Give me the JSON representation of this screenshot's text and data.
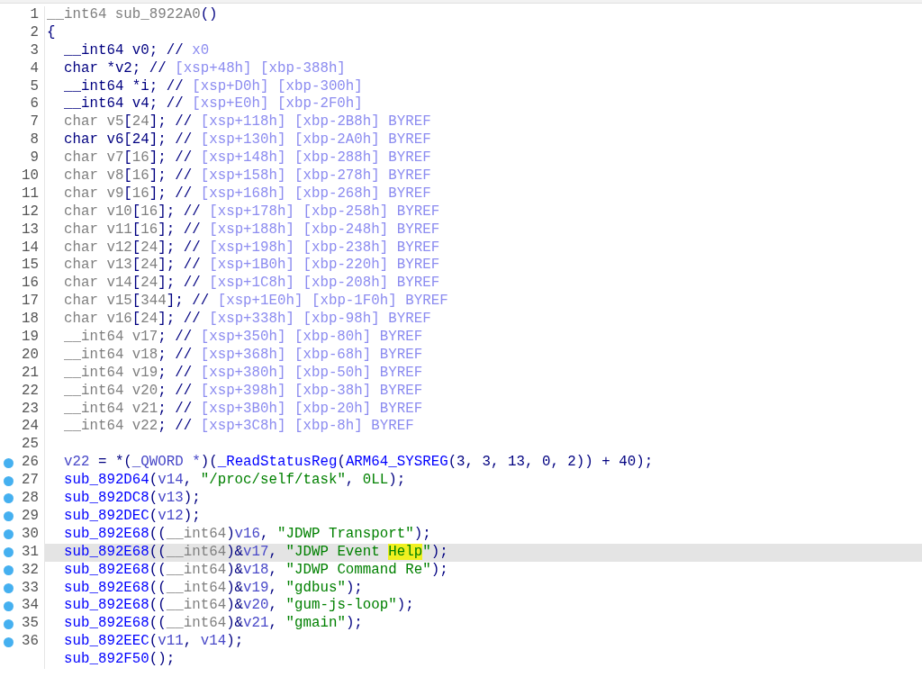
{
  "code_view": {
    "lines": [
      {
        "number": "1",
        "breakpoint": false,
        "selected": false,
        "segments": [
          {
            "kind": "g",
            "text": "__int64 sub_8922A0"
          },
          {
            "kind": "t",
            "text": "()"
          }
        ]
      },
      {
        "number": "2",
        "breakpoint": false,
        "selected": false,
        "segments": [
          {
            "kind": "t",
            "text": "{"
          }
        ],
        "children": [
          {
            "number": "3",
            "breakpoint": false,
            "selected": false,
            "segments": [
              {
                "kind": "t",
                "text": "__int64 v0; // "
              },
              {
                "kind": "c",
                "text": "x0"
              }
            ]
          },
          {
            "number": "4",
            "breakpoint": false,
            "selected": false,
            "segments": [
              {
                "kind": "t",
                "text": "char *v2; // "
              },
              {
                "kind": "c",
                "text": "[xsp+48h] [xbp-388h]"
              }
            ]
          },
          {
            "number": "5",
            "breakpoint": false,
            "selected": false,
            "segments": [
              {
                "kind": "t",
                "text": "__int64 *i; // "
              },
              {
                "kind": "c",
                "text": "[xsp+D0h] [xbp-300h]"
              }
            ]
          },
          {
            "number": "6",
            "breakpoint": false,
            "selected": false,
            "segments": [
              {
                "kind": "t",
                "text": "__int64 v4; // "
              },
              {
                "kind": "c",
                "text": "[xsp+E0h] [xbp-2F0h]"
              }
            ]
          },
          {
            "number": "7",
            "breakpoint": false,
            "selected": false,
            "segments": [
              {
                "kind": "g",
                "text": "char v5"
              },
              {
                "kind": "t",
                "text": "["
              },
              {
                "kind": "g",
                "text": "24"
              },
              {
                "kind": "t",
                "text": "]; // "
              },
              {
                "kind": "c",
                "text": "[xsp+118h] [xbp-2B8h] BYREF"
              }
            ]
          },
          {
            "number": "8",
            "breakpoint": false,
            "selected": false,
            "segments": [
              {
                "kind": "t",
                "text": "char v6[24]; // "
              },
              {
                "kind": "c",
                "text": "[xsp+130h] [xbp-2A0h] BYREF"
              }
            ]
          },
          {
            "number": "9",
            "breakpoint": false,
            "selected": false,
            "segments": [
              {
                "kind": "g",
                "text": "char v7"
              },
              {
                "kind": "t",
                "text": "["
              },
              {
                "kind": "g",
                "text": "16"
              },
              {
                "kind": "t",
                "text": "]; // "
              },
              {
                "kind": "c",
                "text": "[xsp+148h] [xbp-288h] BYREF"
              }
            ]
          },
          {
            "number": "10",
            "breakpoint": false,
            "selected": false,
            "segments": [
              {
                "kind": "g",
                "text": "char v8"
              },
              {
                "kind": "t",
                "text": "["
              },
              {
                "kind": "g",
                "text": "16"
              },
              {
                "kind": "t",
                "text": "]; // "
              },
              {
                "kind": "c",
                "text": "[xsp+158h] [xbp-278h] BYREF"
              }
            ]
          },
          {
            "number": "11",
            "breakpoint": false,
            "selected": false,
            "segments": [
              {
                "kind": "g",
                "text": "char v9"
              },
              {
                "kind": "t",
                "text": "["
              },
              {
                "kind": "g",
                "text": "16"
              },
              {
                "kind": "t",
                "text": "]; // "
              },
              {
                "kind": "c",
                "text": "[xsp+168h] [xbp-268h] BYREF"
              }
            ]
          },
          {
            "number": "12",
            "breakpoint": false,
            "selected": false,
            "segments": [
              {
                "kind": "g",
                "text": "char v10"
              },
              {
                "kind": "t",
                "text": "["
              },
              {
                "kind": "g",
                "text": "16"
              },
              {
                "kind": "t",
                "text": "]; // "
              },
              {
                "kind": "c",
                "text": "[xsp+178h] [xbp-258h] BYREF"
              }
            ]
          },
          {
            "number": "13",
            "breakpoint": false,
            "selected": false,
            "segments": [
              {
                "kind": "g",
                "text": "char v11"
              },
              {
                "kind": "t",
                "text": "["
              },
              {
                "kind": "g",
                "text": "16"
              },
              {
                "kind": "t",
                "text": "]; // "
              },
              {
                "kind": "c",
                "text": "[xsp+188h] [xbp-248h] BYREF"
              }
            ]
          },
          {
            "number": "14",
            "breakpoint": false,
            "selected": false,
            "segments": [
              {
                "kind": "g",
                "text": "char v12"
              },
              {
                "kind": "t",
                "text": "["
              },
              {
                "kind": "g",
                "text": "24"
              },
              {
                "kind": "t",
                "text": "]; // "
              },
              {
                "kind": "c",
                "text": "[xsp+198h] [xbp-238h] BYREF"
              }
            ]
          },
          {
            "number": "15",
            "breakpoint": false,
            "selected": false,
            "segments": [
              {
                "kind": "g",
                "text": "char v13"
              },
              {
                "kind": "t",
                "text": "["
              },
              {
                "kind": "g",
                "text": "24"
              },
              {
                "kind": "t",
                "text": "]; // "
              },
              {
                "kind": "c",
                "text": "[xsp+1B0h] [xbp-220h] BYREF"
              }
            ]
          },
          {
            "number": "16",
            "breakpoint": false,
            "selected": false,
            "segments": [
              {
                "kind": "g",
                "text": "char v14"
              },
              {
                "kind": "t",
                "text": "["
              },
              {
                "kind": "g",
                "text": "24"
              },
              {
                "kind": "t",
                "text": "]; // "
              },
              {
                "kind": "c",
                "text": "[xsp+1C8h] [xbp-208h] BYREF"
              }
            ]
          },
          {
            "number": "17",
            "breakpoint": false,
            "selected": false,
            "segments": [
              {
                "kind": "g",
                "text": "char v15"
              },
              {
                "kind": "t",
                "text": "["
              },
              {
                "kind": "g",
                "text": "344"
              },
              {
                "kind": "t",
                "text": "]; // "
              },
              {
                "kind": "c",
                "text": "[xsp+1E0h] [xbp-1F0h] BYREF"
              }
            ]
          },
          {
            "number": "18",
            "breakpoint": false,
            "selected": false,
            "segments": [
              {
                "kind": "g",
                "text": "char v16"
              },
              {
                "kind": "t",
                "text": "["
              },
              {
                "kind": "g",
                "text": "24"
              },
              {
                "kind": "t",
                "text": "]; // "
              },
              {
                "kind": "c",
                "text": "[xsp+338h] [xbp-98h] BYREF"
              }
            ]
          },
          {
            "number": "19",
            "breakpoint": false,
            "selected": false,
            "segments": [
              {
                "kind": "g",
                "text": "__int64 v17"
              },
              {
                "kind": "t",
                "text": "; // "
              },
              {
                "kind": "c",
                "text": "[xsp+350h] [xbp-80h] BYREF"
              }
            ]
          },
          {
            "number": "20",
            "breakpoint": false,
            "selected": false,
            "segments": [
              {
                "kind": "g",
                "text": "__int64 v18"
              },
              {
                "kind": "t",
                "text": "; // "
              },
              {
                "kind": "c",
                "text": "[xsp+368h] [xbp-68h] BYREF"
              }
            ]
          },
          {
            "number": "21",
            "breakpoint": false,
            "selected": false,
            "segments": [
              {
                "kind": "g",
                "text": "__int64 v19"
              },
              {
                "kind": "t",
                "text": "; // "
              },
              {
                "kind": "c",
                "text": "[xsp+380h] [xbp-50h] BYREF"
              }
            ]
          },
          {
            "number": "22",
            "breakpoint": false,
            "selected": false,
            "segments": [
              {
                "kind": "g",
                "text": "__int64 v20"
              },
              {
                "kind": "t",
                "text": "; // "
              },
              {
                "kind": "c",
                "text": "[xsp+398h] [xbp-38h] BYREF"
              }
            ]
          },
          {
            "number": "23",
            "breakpoint": false,
            "selected": false,
            "segments": [
              {
                "kind": "g",
                "text": "__int64 v21"
              },
              {
                "kind": "t",
                "text": "; // "
              },
              {
                "kind": "c",
                "text": "[xsp+3B0h] [xbp-20h] BYREF"
              }
            ]
          },
          {
            "number": "24",
            "breakpoint": false,
            "selected": false,
            "segments": [
              {
                "kind": "g",
                "text": "__int64 v22"
              },
              {
                "kind": "t",
                "text": "; // "
              },
              {
                "kind": "c",
                "text": "[xsp+3C8h] [xbp-8h] BYREF"
              }
            ]
          },
          {
            "number": "25",
            "breakpoint": false,
            "selected": false
          },
          {
            "number": "26",
            "breakpoint": true,
            "selected": false,
            "segments": [
              {
                "kind": "v",
                "text": "v22"
              },
              {
                "kind": "t",
                "text": " = *("
              },
              {
                "kind": "v",
                "text": "_QWORD *"
              },
              {
                "kind": "t",
                "text": ")("
              },
              {
                "kind": "f",
                "text": "_ReadStatusReg"
              },
              {
                "kind": "t",
                "text": "("
              },
              {
                "kind": "f",
                "text": "ARM64_SYSREG"
              },
              {
                "kind": "t",
                "text": "(3, 3, 13, 0, 2)) + 40);"
              }
            ]
          },
          {
            "number": "27",
            "breakpoint": true,
            "selected": false,
            "segments": [
              {
                "kind": "f",
                "text": "sub_892D64"
              },
              {
                "kind": "t",
                "text": "("
              },
              {
                "kind": "v",
                "text": "v14"
              },
              {
                "kind": "t",
                "text": ", "
              },
              {
                "kind": "s",
                "text": "\"/proc/self/task\""
              },
              {
                "kind": "t",
                "text": ", "
              },
              {
                "kind": "s",
                "text": "0LL"
              },
              {
                "kind": "t",
                "text": ");"
              }
            ]
          },
          {
            "number": "28",
            "breakpoint": true,
            "selected": false,
            "segments": [
              {
                "kind": "f",
                "text": "sub_892DC8"
              },
              {
                "kind": "t",
                "text": "("
              },
              {
                "kind": "v",
                "text": "v13"
              },
              {
                "kind": "t",
                "text": ");"
              }
            ]
          },
          {
            "number": "29",
            "breakpoint": true,
            "selected": false,
            "segments": [
              {
                "kind": "f",
                "text": "sub_892DEC"
              },
              {
                "kind": "t",
                "text": "("
              },
              {
                "kind": "v",
                "text": "v12"
              },
              {
                "kind": "t",
                "text": ");"
              }
            ]
          },
          {
            "number": "30",
            "breakpoint": true,
            "selected": false,
            "segments": [
              {
                "kind": "f",
                "text": "sub_892E68"
              },
              {
                "kind": "t",
                "text": "(("
              },
              {
                "kind": "g",
                "text": "__int64"
              },
              {
                "kind": "t",
                "text": ")"
              },
              {
                "kind": "v",
                "text": "v16"
              },
              {
                "kind": "t",
                "text": ", "
              },
              {
                "kind": "s",
                "text": "\"JDWP Transport\""
              },
              {
                "kind": "t",
                "text": ");"
              }
            ]
          },
          {
            "number": "31",
            "breakpoint": true,
            "selected": true,
            "segments": [
              {
                "kind": "f",
                "text": "sub_892E68"
              },
              {
                "kind": "t",
                "text": "(("
              },
              {
                "kind": "g",
                "text": "__int64"
              },
              {
                "kind": "t",
                "text": ")&"
              },
              {
                "kind": "v",
                "text": "v17"
              },
              {
                "kind": "t",
                "text": ", "
              },
              {
                "kind": "s",
                "text": "\"JDWP Event "
              },
              {
                "kind": "h",
                "text": "Help"
              },
              {
                "kind": "s",
                "text": "\""
              },
              {
                "kind": "t",
                "text": ");"
              }
            ]
          },
          {
            "number": "32",
            "breakpoint": true,
            "selected": false,
            "segments": [
              {
                "kind": "f",
                "text": "sub_892E68"
              },
              {
                "kind": "t",
                "text": "(("
              },
              {
                "kind": "g",
                "text": "__int64"
              },
              {
                "kind": "t",
                "text": ")&"
              },
              {
                "kind": "v",
                "text": "v18"
              },
              {
                "kind": "t",
                "text": ", "
              },
              {
                "kind": "s",
                "text": "\"JDWP Command Re\""
              },
              {
                "kind": "t",
                "text": ");"
              }
            ]
          },
          {
            "number": "33",
            "breakpoint": true,
            "selected": false,
            "segments": [
              {
                "kind": "f",
                "text": "sub_892E68"
              },
              {
                "kind": "t",
                "text": "(("
              },
              {
                "kind": "g",
                "text": "__int64"
              },
              {
                "kind": "t",
                "text": ")&"
              },
              {
                "kind": "v",
                "text": "v19"
              },
              {
                "kind": "t",
                "text": ", "
              },
              {
                "kind": "s",
                "text": "\"gdbus\""
              },
              {
                "kind": "t",
                "text": ");"
              }
            ]
          },
          {
            "number": "34",
            "breakpoint": true,
            "selected": false,
            "segments": [
              {
                "kind": "f",
                "text": "sub_892E68"
              },
              {
                "kind": "t",
                "text": "(("
              },
              {
                "kind": "g",
                "text": "__int64"
              },
              {
                "kind": "t",
                "text": ")&"
              },
              {
                "kind": "v",
                "text": "v20"
              },
              {
                "kind": "t",
                "text": ", "
              },
              {
                "kind": "s",
                "text": "\"gum-js-loop\""
              },
              {
                "kind": "t",
                "text": ");"
              }
            ]
          },
          {
            "number": "35",
            "breakpoint": true,
            "selected": false,
            "segments": [
              {
                "kind": "f",
                "text": "sub_892E68"
              },
              {
                "kind": "t",
                "text": "(("
              },
              {
                "kind": "g",
                "text": "__int64"
              },
              {
                "kind": "t",
                "text": ")&"
              },
              {
                "kind": "v",
                "text": "v21"
              },
              {
                "kind": "t",
                "text": ", "
              },
              {
                "kind": "s",
                "text": "\"gmain\""
              },
              {
                "kind": "t",
                "text": ");"
              }
            ]
          },
          {
            "number": "36",
            "breakpoint": true,
            "selected": false,
            "segments": [
              {
                "kind": "f",
                "text": "sub_892EEC"
              },
              {
                "kind": "t",
                "text": "("
              },
              {
                "kind": "v",
                "text": "v11"
              },
              {
                "kind": "t",
                "text": ", "
              },
              {
                "kind": "v",
                "text": "v14"
              },
              {
                "kind": "t",
                "text": ");"
              }
            ]
          },
          {
            "breakpoint": false,
            "selected": false,
            "segments": [
              {
                "kind": "f",
                "text": "sub_892F50"
              },
              {
                "kind": "t",
                "text": "();"
              }
            ]
          }
        ]
      }
    ]
  }
}
